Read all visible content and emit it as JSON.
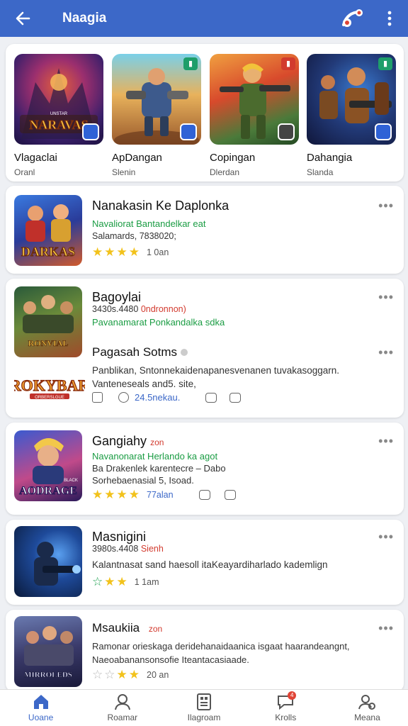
{
  "header": {
    "title": "Naagia"
  },
  "featured": [
    {
      "name": "Vlagaclai",
      "sub": "Oranl",
      "art_text": "NARAVAS",
      "art_small": "UNSTAR"
    },
    {
      "name": "ApDangan",
      "sub": "Slenin"
    },
    {
      "name": "Copingan",
      "sub": "Dlerdan"
    },
    {
      "name": "Dahangia",
      "sub": "Slanda"
    }
  ],
  "list": [
    {
      "name": "Nanakasin Ke Daplonka",
      "line": "Navaliorat Bantandelkar eat",
      "meta": "Salamards, 7838020;",
      "rating_count": "1 0an",
      "art_text": "DARKAS"
    },
    {
      "name": "Bagoylai",
      "meta": "3430s.4480",
      "meta_red": "0ndronnon)",
      "line": "Pavanamarat Ponkandalka sdka",
      "art_text": "RONVIAL"
    },
    {
      "name": "Pagasah Sotms",
      "desc": "Panblikan, Sntonnekaidenapanesvenanen tuvakasoggarn. Vanteneseals and5. site,",
      "link": "24.5nekau.",
      "art_text": "ROKYBAR",
      "art_small": "ORBERSLGUE"
    },
    {
      "name": "Gangiahy",
      "tag": "zon",
      "line": "Navanonarat Herlando ka agot",
      "desc": "Ba Drakenlek karentecre – Dabo Sorhebaenasial 5, Isoad.",
      "rating_count": "77alan",
      "art_text": "AODRAGE",
      "art_small": "BLACK"
    },
    {
      "name": "Masnigini",
      "meta": "3980s.4408",
      "meta_red": "Sienh",
      "desc": "Kalantnasat sand haesoll itaKeayardiharlado kademlign",
      "rating_count": "1 1am"
    },
    {
      "name": "Msaukiia",
      "tag": "zon",
      "desc": "Ramonar orieskaga deridehanaidaanica isgaat haarandeangnt, Naeoabanansonsofie Iteantacasiaade.",
      "rating_count": "20 an",
      "art_text": "MIRROLEDS"
    }
  ],
  "tabs": [
    {
      "label": "Uoane"
    },
    {
      "label": "Roamar"
    },
    {
      "label": "Ilagroam"
    },
    {
      "label": "Krolls",
      "badge": "4"
    },
    {
      "label": "Meana"
    }
  ]
}
